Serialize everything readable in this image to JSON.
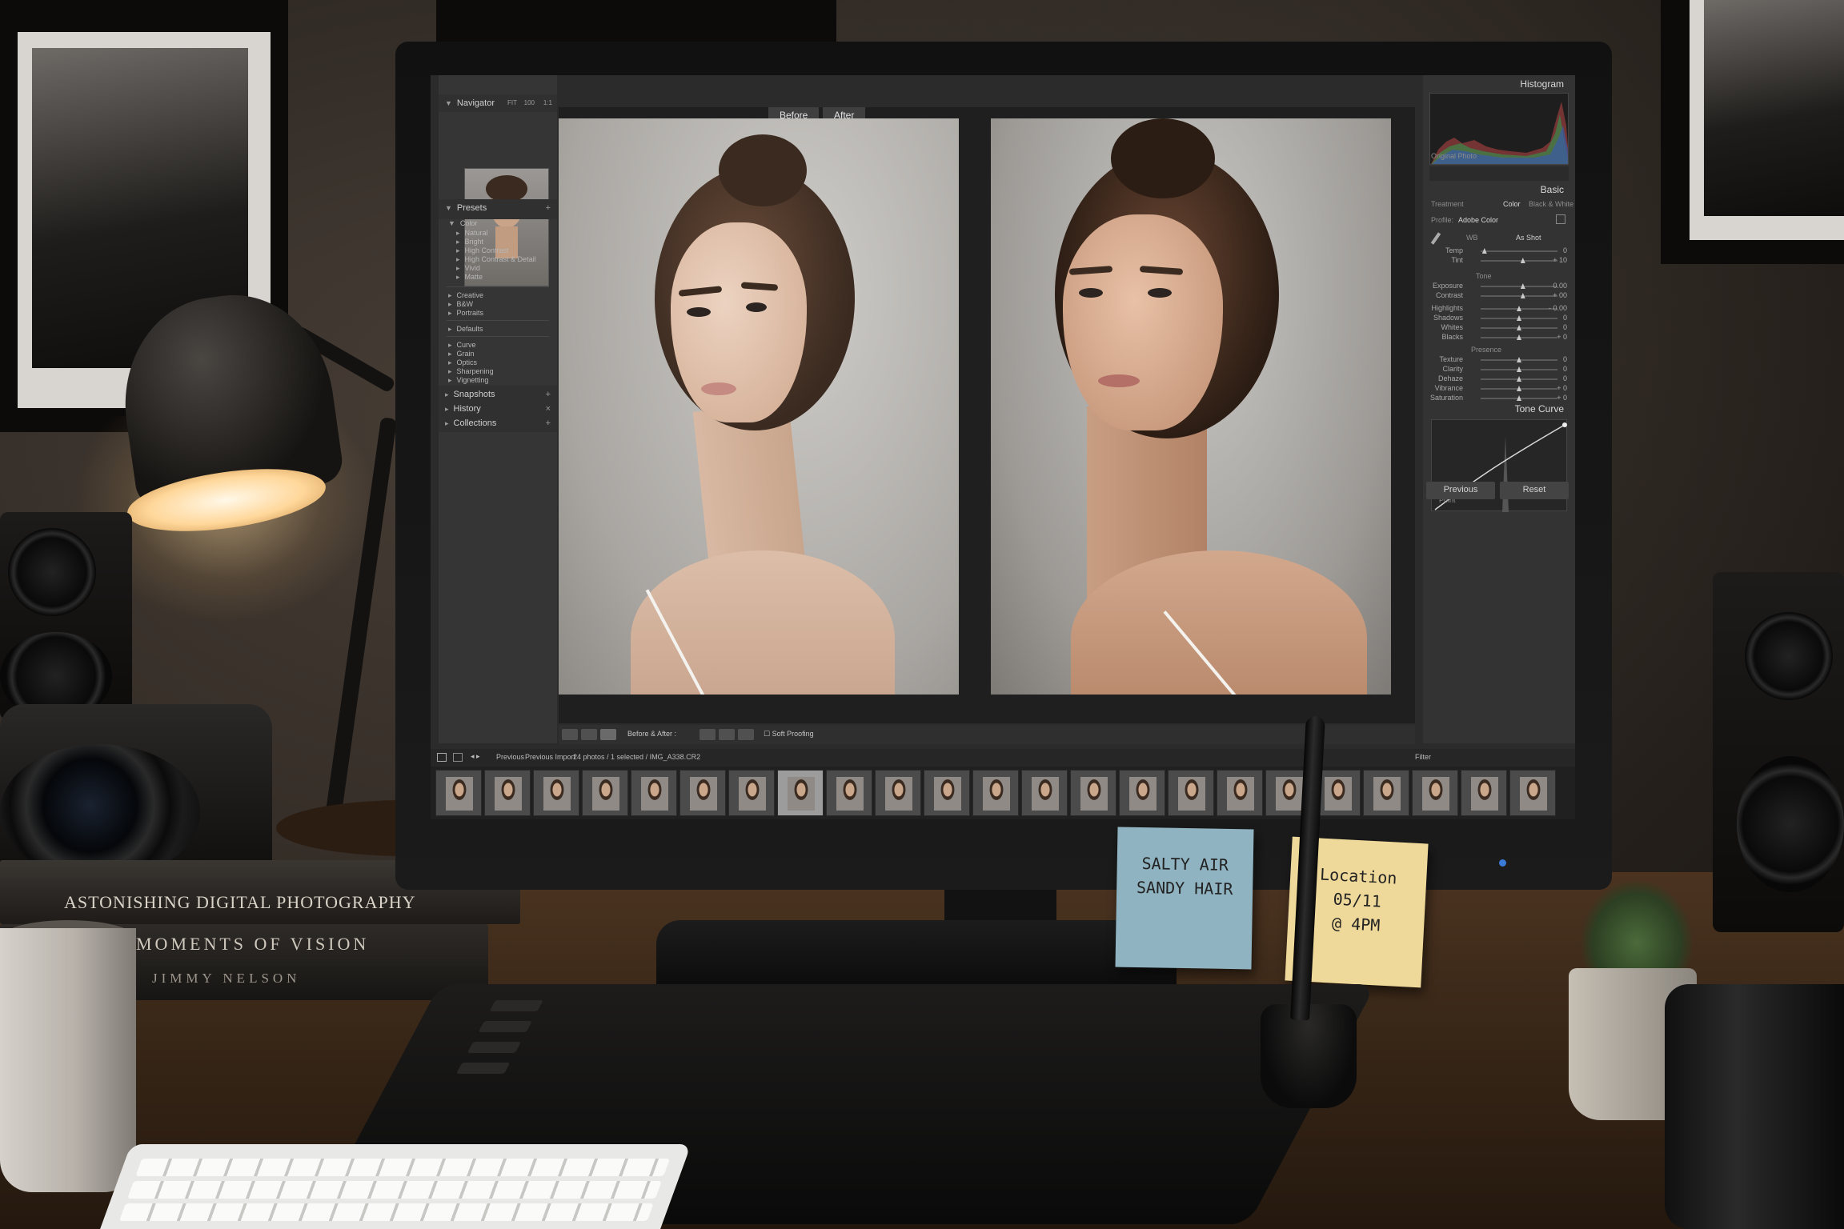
{
  "scene": {
    "books": {
      "top_title": "ASTONISHING DIGITAL PHOTOGRAPHY",
      "middle_title": "MOMENTS OF VISION",
      "middle_author": "JIMMY NELSON"
    },
    "sticky_left": {
      "line1": "SALTY AIR",
      "line2": "SANDY HAIR"
    },
    "sticky_right": {
      "line1": "Location",
      "line2": "05/11",
      "line3": "@ 4PM"
    }
  },
  "app": {
    "left_panel": {
      "navigator": {
        "title": "Navigator",
        "zoom_options": [
          "FIT",
          "100",
          "1:1"
        ]
      },
      "presets": {
        "title": "Presets",
        "color_group": "Color",
        "color_items": [
          "Natural",
          "Bright",
          "High Contrast",
          "High Contrast & Detail",
          "Vivid",
          "Matte"
        ],
        "groups_a": [
          "Creative",
          "B&W",
          "Portraits"
        ],
        "groups_b": [
          "Defaults"
        ],
        "groups_c": [
          "Curve",
          "Grain",
          "Optics",
          "Sharpening",
          "Vignetting"
        ]
      },
      "snapshots": "Snapshots",
      "history": "History",
      "collections": "Collections"
    },
    "compare": {
      "before": "Before",
      "after": "After"
    },
    "toolbar": {
      "mode_label": "Before & After :",
      "soft_proofing": "Soft Proofing"
    },
    "right_panel": {
      "histogram": {
        "title": "Histogram",
        "original_photo": "Original Photo"
      },
      "basic": {
        "title": "Basic",
        "treatment_label": "Treatment",
        "treatment_color": "Color",
        "treatment_bw": "Black & White",
        "profile_label": "Profile:",
        "profile_value": "Adobe Color",
        "wb_label": "WB",
        "wb_value": "As Shot",
        "rows_wb": [
          {
            "label": "Temp",
            "value": "0",
            "pos": 0.05
          },
          {
            "label": "Tint",
            "value": "+ 10",
            "pos": 0.55
          }
        ],
        "tone_label": "Tone",
        "rows_tone": [
          {
            "label": "Exposure",
            "value": "0.00",
            "pos": 0.55
          },
          {
            "label": "Contrast",
            "value": "+ 00",
            "pos": 0.55
          }
        ],
        "rows_tone2": [
          {
            "label": "Highlights",
            "value": "- 0.00",
            "pos": 0.5
          },
          {
            "label": "Shadows",
            "value": "0",
            "pos": 0.5
          },
          {
            "label": "Whites",
            "value": "0",
            "pos": 0.5
          },
          {
            "label": "Blacks",
            "value": "+ 0",
            "pos": 0.5
          }
        ],
        "presence_label": "Presence",
        "rows_presence": [
          {
            "label": "Texture",
            "value": "0",
            "pos": 0.5
          },
          {
            "label": "Clarity",
            "value": "0",
            "pos": 0.5
          },
          {
            "label": "Dehaze",
            "value": "0",
            "pos": 0.5
          }
        ],
        "rows_presence2": [
          {
            "label": "Vibrance",
            "value": "+ 0",
            "pos": 0.5
          },
          {
            "label": "Saturation",
            "value": "+ 0",
            "pos": 0.5
          }
        ]
      },
      "tone_curve": {
        "title": "Tone Curve",
        "point_label": "Point"
      },
      "previous_button": "Previous",
      "reset_button": "Reset"
    },
    "filmstrip": {
      "previous_label": "Previous",
      "previous_import": "Previous Import",
      "count_text": "24 photos / 1 selected / IMG_A338.CR2",
      "filter_label": "Filter"
    },
    "colors": {
      "panel_bg": "#353535",
      "accent_led": "#3a7bd8",
      "sticky_blue": "#8fb3c1",
      "sticky_yellow": "#efd99a"
    }
  }
}
